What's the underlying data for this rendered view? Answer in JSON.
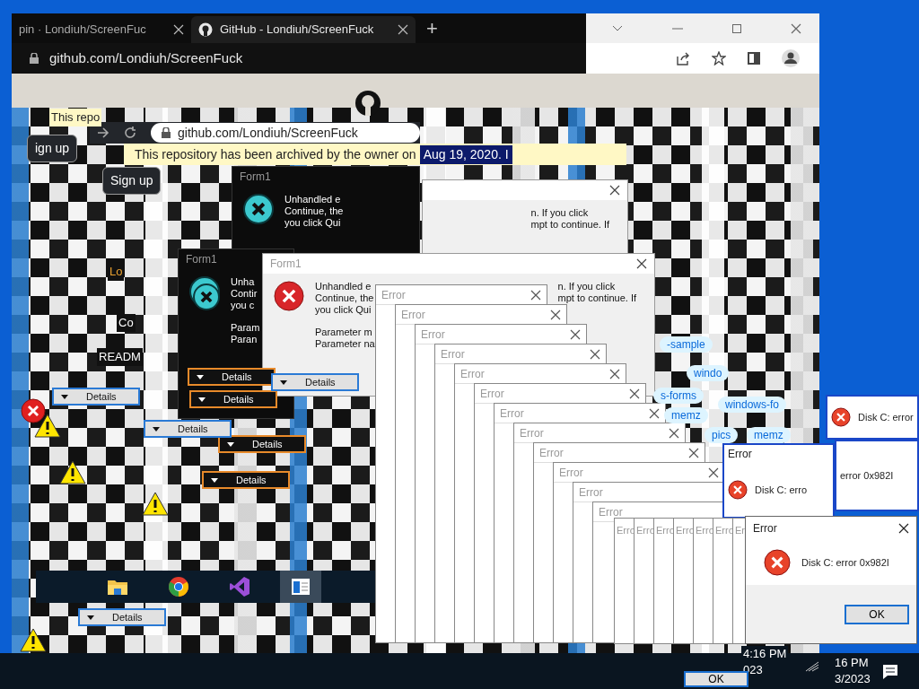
{
  "browser": {
    "tabs": [
      {
        "label": "pin · Londiuh/ScreenFuc",
        "selected": false
      },
      {
        "label": "GitHub - Londiuh/ScreenFuck",
        "selected": true
      }
    ],
    "new_tab": "+",
    "address": "github.com/Londiuh/ScreenFuck"
  },
  "inner_browser": {
    "address": "github.com/Londiuh/ScreenFuck",
    "banner": "This repository has been archived by the owner on",
    "banner_highlight": "Aug 19, 2020. I"
  },
  "sign_up_buttons": [
    "ign up",
    "Sign up"
  ],
  "fragments": [
    "This repo",
    "Lo",
    "Co",
    "READM"
  ],
  "form_dialogs": [
    {
      "kind": "dark",
      "title": "Form1",
      "lines": [
        "Unhandled e",
        "Continue, the",
        "you click Qui"
      ]
    },
    {
      "kind": "light",
      "right_lines": [
        "n. If you click",
        "mpt to continue. If"
      ]
    },
    {
      "kind": "dark",
      "title": "Form1",
      "lines": [
        "Unha",
        "Contir",
        "you c"
      ],
      "params": [
        "Param",
        "Paran"
      ]
    },
    {
      "kind": "light",
      "title": "Form1",
      "lines": [
        "Unhandled e",
        "Continue, the",
        "you click Qui"
      ],
      "right_lines": [
        "n. If you click",
        "mpt to continue. If"
      ],
      "params": [
        "Parameter m",
        "Parameter na"
      ]
    }
  ],
  "details_buttons": [
    {
      "label": "Details",
      "kind": "dark"
    },
    {
      "label": "Details",
      "kind": "dark"
    },
    {
      "label": "Details",
      "kind": "dark"
    },
    {
      "label": "Details",
      "kind": "dark"
    },
    {
      "label": "Details",
      "kind": "light"
    },
    {
      "label": "Details",
      "kind": "light"
    },
    {
      "label": "Details",
      "kind": "light"
    },
    {
      "label": "Details",
      "kind": "light"
    }
  ],
  "error_windows": [
    "Error",
    "Error",
    "Error",
    "Error",
    "Error",
    "Error",
    "Error",
    "Error",
    "Error",
    "Error",
    "Error",
    "Error"
  ],
  "narrow_error_windows": [
    "Erro",
    "Erro",
    "Erro",
    "Erro",
    "Erro",
    "Erro",
    "Er"
  ],
  "topics": [
    "-sample",
    "windo",
    "s-forms",
    "memz",
    "windows-fo",
    "pics",
    "memz"
  ],
  "disk_dialogs": [
    {
      "message": "Disk C: error"
    },
    {
      "title": "Error",
      "message": "Disk C: erro"
    },
    {
      "message": "error 0x982I"
    }
  ],
  "final_dialog": {
    "title": "Error",
    "message": "Disk C: error 0x982I",
    "button": "OK"
  },
  "stray_button": "OK",
  "taskbar": {
    "apps": [
      {
        "kind": "folder",
        "selected": false
      },
      {
        "kind": "chrome",
        "selected": false
      },
      {
        "kind": "vs",
        "selected": false
      },
      {
        "kind": "app",
        "selected": true
      }
    ],
    "clocks": [
      {
        "time": "4:16 PM",
        "date": "023"
      },
      {
        "time": "16 PM",
        "date": "3/2023"
      }
    ]
  }
}
